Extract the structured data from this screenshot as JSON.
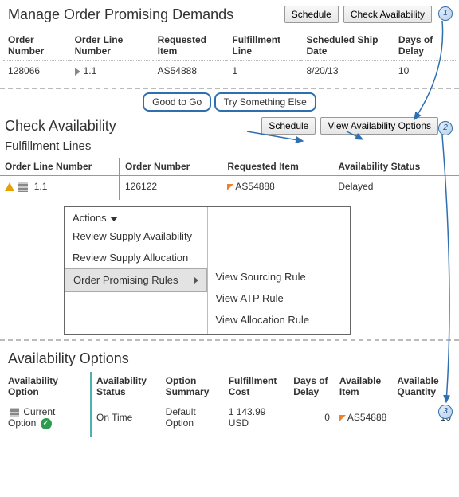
{
  "panel1": {
    "title": "Manage Order Promising Demands",
    "schedule_btn": "Schedule",
    "check_btn": "Check Availability",
    "cols": [
      "Order Number",
      "Order Line Number",
      "Requested Item",
      "Fulfillment Line",
      "Scheduled Ship Date",
      "Days of Delay"
    ],
    "row": {
      "order_number": "128066",
      "order_line": "1.1",
      "item": "AS54888",
      "fline": "1",
      "ship_date": "8/20/13",
      "delay": "10"
    }
  },
  "bubbles": {
    "good": "Good to Go",
    "try": "Try Something Else"
  },
  "panel2": {
    "title": "Check Availability",
    "schedule_btn": "Schedule",
    "view_btn": "View Availability Options",
    "sub": "Fulfillment Lines",
    "cols": [
      "Order Line Number",
      "Order Number",
      "Requested Item",
      "Availability Status"
    ],
    "row": {
      "oln": "1.1",
      "on": "126122",
      "item": "AS54888",
      "status": "Delayed"
    },
    "menu": {
      "actions": "Actions",
      "rsa": "Review Supply Availability",
      "rsal": "Review Supply Allocation",
      "opr": "Order Promising Rules",
      "vsr": "View Sourcing Rule",
      "vatp": "View ATP Rule",
      "var": "View Allocation Rule"
    }
  },
  "panel3": {
    "title": "Availability Options",
    "cols": [
      "Availability Option",
      "Availability Status",
      "Option Summary",
      "Fulfillment Cost",
      "Days of Delay",
      "Available Item",
      "Available Quantity"
    ],
    "row": {
      "opt": "Current Option",
      "status": "On Time",
      "summary": "Default Option",
      "cost": "1 143.99 USD",
      "delay": "0",
      "item": "AS54888",
      "qty": "10"
    }
  },
  "badges": {
    "b1": "1",
    "b2": "2",
    "b3": "3"
  }
}
